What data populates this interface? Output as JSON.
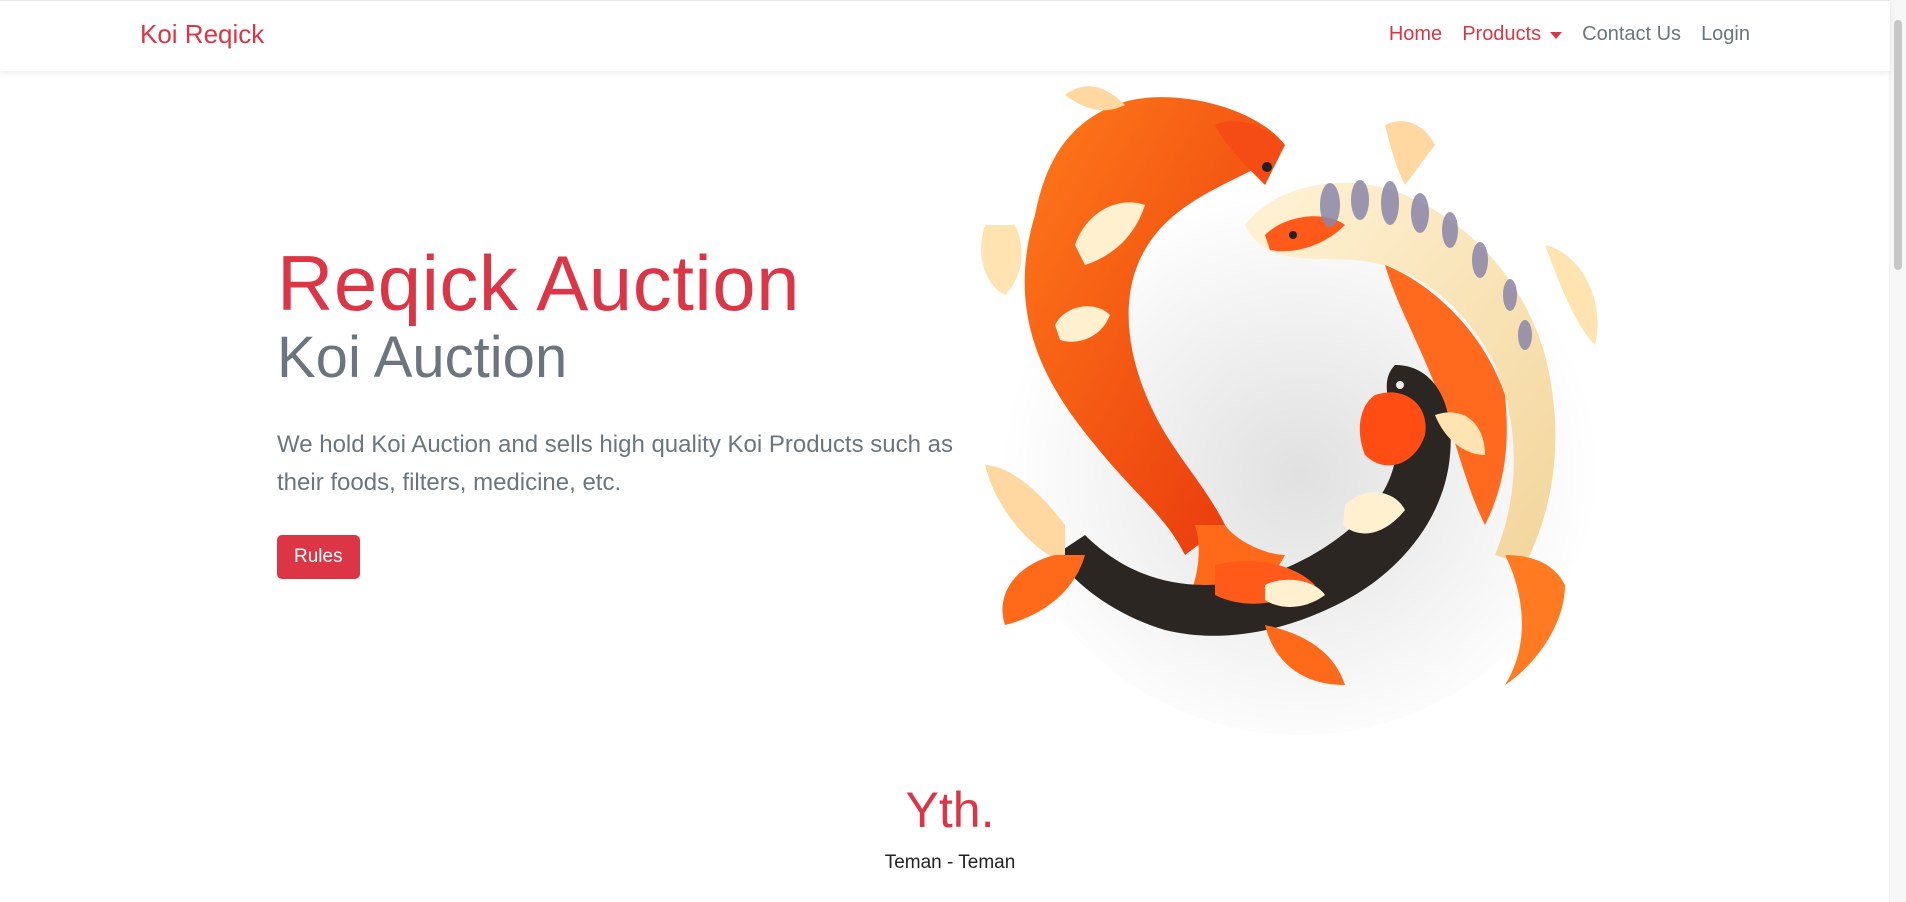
{
  "navbar": {
    "brand": "Koi Reqick",
    "links": [
      {
        "label": "Home",
        "active": true
      },
      {
        "label": "Products",
        "active": true,
        "dropdown": true
      },
      {
        "label": "Contact Us",
        "active": false
      },
      {
        "label": "Login",
        "active": false
      }
    ]
  },
  "hero": {
    "title": "Reqick Auction",
    "subtitle": "Koi Auction",
    "description": "We hold Koi Auction and sells high quality Koi Products such as their foods, filters, medicine, etc.",
    "button_label": "Rules",
    "image": "koi-fish-illustration"
  },
  "about": {
    "heading": "Yth.",
    "subheading": "Teman - Teman"
  },
  "colors": {
    "accent": "#dc3545",
    "muted": "#6c757d"
  }
}
